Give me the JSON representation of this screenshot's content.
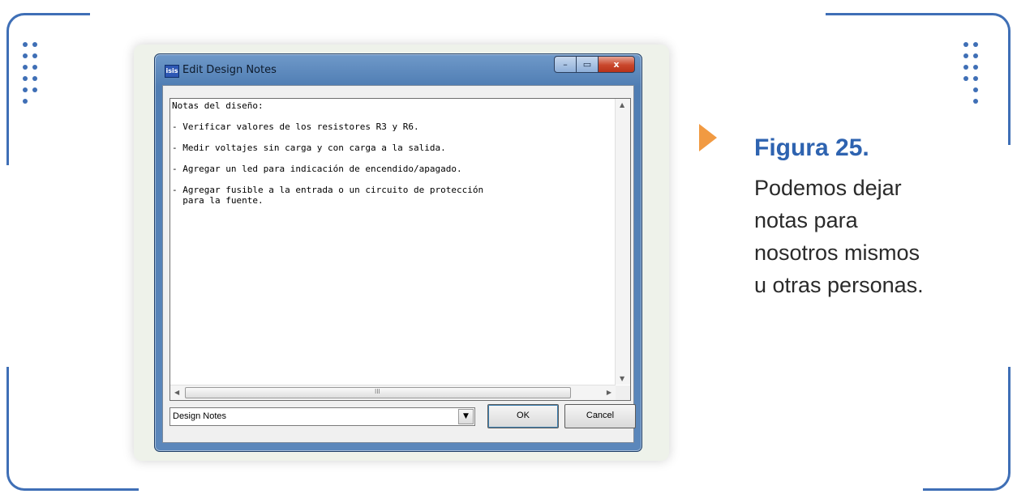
{
  "window": {
    "title": "Edit Design Notes",
    "app_icon_text": "isis",
    "controls": {
      "minimize": "–",
      "maximize": "▭",
      "close": "x"
    }
  },
  "notes": {
    "lines": [
      "Notas del diseño:",
      "",
      "- Verificar valores de los resistores R3 y R6.",
      "",
      "- Medir voltajes sin carga y con carga a la salida.",
      "",
      "- Agregar un led para indicación de encendido/apagado.",
      "",
      "- Agregar fusible a la entrada o un circuito de protección",
      "  para la fuente."
    ]
  },
  "scrollbars": {
    "up": "▲",
    "down": "▼",
    "left": "◀",
    "right": "▶",
    "grip": "III"
  },
  "combo": {
    "value": "Design Notes",
    "arrow": "▼"
  },
  "buttons": {
    "ok": "OK",
    "cancel": "Cancel"
  },
  "caption": {
    "title": "Figura 25.",
    "lines": [
      "Podemos dejar",
      "notas para",
      "nosotros mismos",
      "u otras personas."
    ]
  },
  "colors": {
    "frame": "#3f6fb6",
    "accent_arrow": "#f19a42",
    "caption_title": "#2e63b0"
  }
}
